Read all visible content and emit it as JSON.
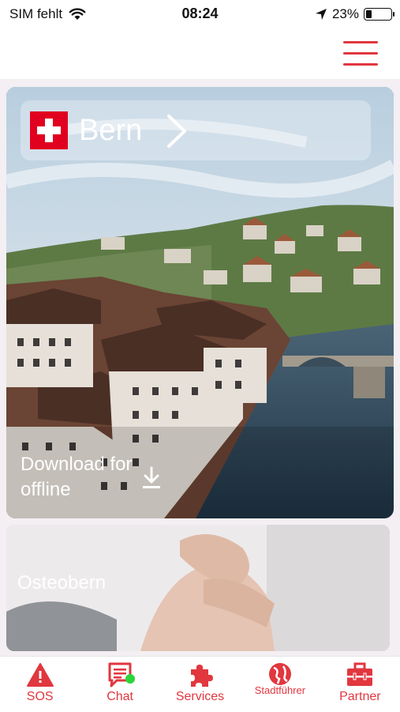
{
  "status_bar": {
    "carrier": "SIM fehlt",
    "time": "08:24",
    "battery": "23%",
    "battery_level": 0.23
  },
  "header": {
    "menu_icon": "hamburger-menu-icon"
  },
  "hero": {
    "city": "Bern",
    "flag_icon": "swiss-flag-icon",
    "download_text": "Download for offline"
  },
  "partner_card": {
    "title": "Osteobern"
  },
  "tabs": [
    {
      "label": "SOS",
      "icon": "warning-triangle-icon"
    },
    {
      "label": "Chat",
      "icon": "chat-bubble-icon"
    },
    {
      "label": "Services",
      "icon": "puzzle-piece-icon"
    },
    {
      "label": "Stadtführer",
      "icon": "globe-icon"
    },
    {
      "label": "Partner",
      "icon": "toolbox-icon"
    }
  ],
  "colors": {
    "accent": "#e1373f",
    "online": "#2bd43b",
    "flag": "#e1001f"
  }
}
